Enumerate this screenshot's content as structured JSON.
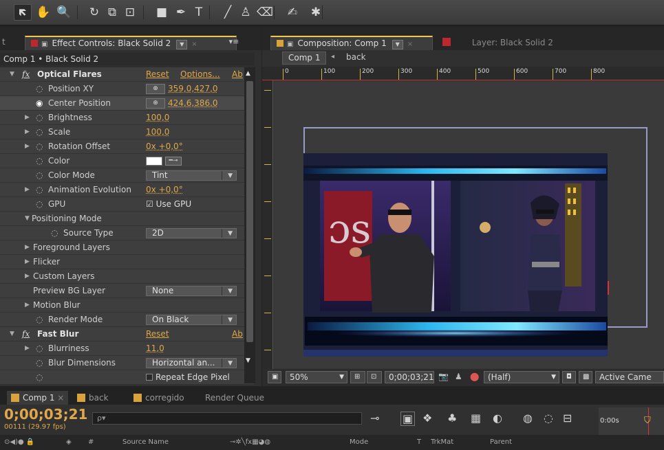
{
  "toolbar": {
    "tools": [
      {
        "name": "selection-tool",
        "glyph": "🡼"
      },
      {
        "name": "hand-tool",
        "glyph": "✋"
      },
      {
        "name": "zoom-tool",
        "glyph": "🔍"
      },
      {
        "name": "rotate-tool",
        "glyph": "↻"
      },
      {
        "name": "camera-tool",
        "glyph": "⧉"
      },
      {
        "name": "pan-behind-tool",
        "glyph": "⊡"
      },
      {
        "name": "rectangle-tool",
        "glyph": "■"
      },
      {
        "name": "pen-tool",
        "glyph": "✒"
      },
      {
        "name": "type-tool",
        "glyph": "T"
      },
      {
        "name": "brush-tool",
        "glyph": "╱"
      },
      {
        "name": "clone-stamp-tool",
        "glyph": "♙"
      },
      {
        "name": "eraser-tool",
        "glyph": "⌫"
      },
      {
        "name": "roto-brush-tool",
        "glyph": "✍"
      },
      {
        "name": "puppet-tool",
        "glyph": "✱"
      }
    ]
  },
  "effect_controls": {
    "tab_left_stub": "t",
    "tab_label": "Effect Controls: Black Solid 2",
    "breadcrumb": "Comp 1 • Black Solid 2",
    "optical_flares": {
      "fx": "fx",
      "name": "Optical Flares",
      "reset": "Reset",
      "options": "Options...",
      "about": "Ab"
    },
    "rows": {
      "position_xy": {
        "label": "Position XY",
        "value": "359,0,427,0"
      },
      "center_position": {
        "label": "Center Position",
        "value": "424,6,386,0"
      },
      "brightness": {
        "label": "Brightness",
        "value": "100,0"
      },
      "scale": {
        "label": "Scale",
        "value": "100,0"
      },
      "rotation_offset": {
        "label": "Rotation Offset",
        "value": "0x +0,0°"
      },
      "color": {
        "label": "Color"
      },
      "color_mode": {
        "label": "Color Mode",
        "value": "Tint"
      },
      "animation_evolution": {
        "label": "Animation Evolution",
        "value": "0x +0,0°"
      },
      "gpu": {
        "label": "GPU",
        "value": "Use GPU"
      },
      "positioning_mode": {
        "label": "Positioning Mode"
      },
      "source_type": {
        "label": "Source Type",
        "value": "2D"
      },
      "foreground_layers": {
        "label": "Foreground Layers"
      },
      "flicker": {
        "label": "Flicker"
      },
      "custom_layers": {
        "label": "Custom Layers"
      },
      "preview_bg_layer": {
        "label": "Preview BG Layer",
        "value": "None"
      },
      "motion_blur": {
        "label": "Motion Blur"
      },
      "render_mode": {
        "label": "Render Mode",
        "value": "On Black"
      }
    },
    "fast_blur": {
      "fx": "fx",
      "name": "Fast Blur",
      "reset": "Reset",
      "about": "Ab",
      "blurriness": {
        "label": "Blurriness",
        "value": "11,0"
      },
      "blur_dimensions": {
        "label": "Blur Dimensions",
        "value": "Horizontal an..."
      },
      "repeat_edge": {
        "label": "Repeat Edge Pixel"
      }
    }
  },
  "composition": {
    "tab_label": "Composition: Comp 1",
    "layer_tab_label": "Layer: Black Solid 2",
    "crumbs": [
      "Comp 1",
      "back"
    ],
    "ruler_labels": [
      "0",
      "100",
      "200",
      "300",
      "400",
      "500",
      "600",
      "700",
      "800"
    ],
    "viewer_bar": {
      "zoom": "50%",
      "timecode": "0;00;03;21",
      "resolution": "(Half)",
      "camera": "Active Came"
    }
  },
  "timeline": {
    "tabs": [
      {
        "label": "Comp 1",
        "color": "#d9a23b",
        "active": true
      },
      {
        "label": "back",
        "color": "#d9a23b",
        "active": false
      },
      {
        "label": "corregido",
        "color": "#d9a23b",
        "active": false
      },
      {
        "label": "Render Queue",
        "color": "",
        "active": false
      }
    ],
    "timecode": "0;00;03;21",
    "fps": "00111 (29.97 fps)",
    "search_placeholder": "ρ▾",
    "ruler_label": "0:00s",
    "columns": {
      "source_name": "Source Name",
      "mode": "Mode",
      "t": "T",
      "trkmat": "TrkMat",
      "parent": "Parent",
      "hash": "#"
    }
  }
}
